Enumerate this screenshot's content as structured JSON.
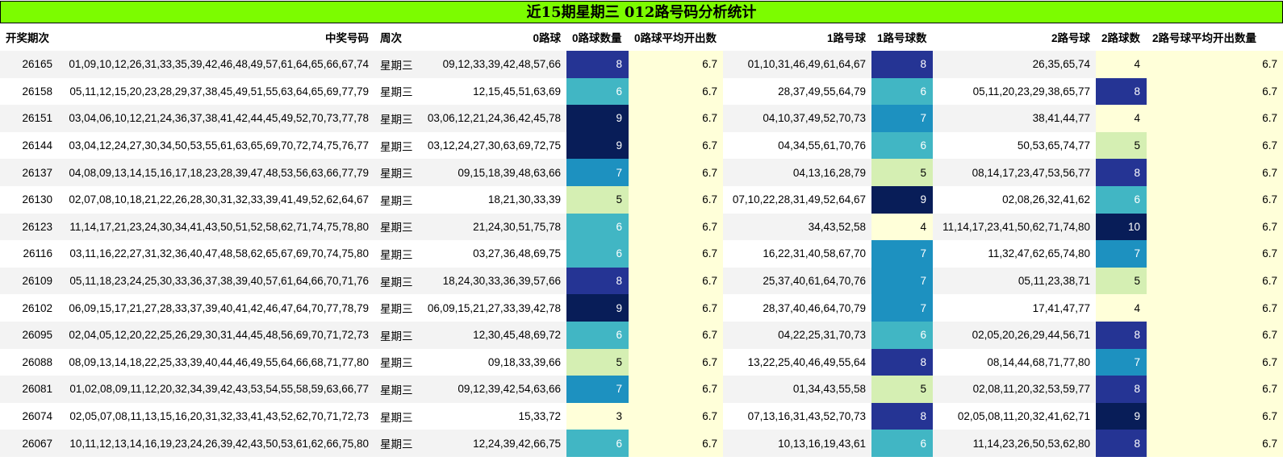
{
  "title": "近15期星期三 012路号码分析统计",
  "headers": [
    "开奖期次",
    "中奖号码",
    "周次",
    "0路球",
    "0路球数量",
    "0路球平均开出数",
    "1路号球",
    "1路号球数",
    "2路号球",
    "2路球数",
    "2路号球平均开出数量"
  ],
  "rows": [
    {
      "period": "26165",
      "numbers": "01,09,10,12,26,31,33,35,39,42,46,48,49,57,61,64,65,66,67,74",
      "weekday": "星期三",
      "r0": "09,12,33,39,42,48,57,66",
      "r0c": "8",
      "r0avg": "6.7",
      "r1": "01,10,31,46,49,61,64,67",
      "r1c": "8",
      "r2": "26,35,65,74",
      "r2c": "4",
      "r2avg": "6.7"
    },
    {
      "period": "26158",
      "numbers": "05,11,12,15,20,23,28,29,37,38,45,49,51,55,63,64,65,69,77,79",
      "weekday": "星期三",
      "r0": "12,15,45,51,63,69",
      "r0c": "6",
      "r0avg": "6.7",
      "r1": "28,37,49,55,64,79",
      "r1c": "6",
      "r2": "05,11,20,23,29,38,65,77",
      "r2c": "8",
      "r2avg": "6.7"
    },
    {
      "period": "26151",
      "numbers": "03,04,06,10,12,21,24,36,37,38,41,42,44,45,49,52,70,73,77,78",
      "weekday": "星期三",
      "r0": "03,06,12,21,24,36,42,45,78",
      "r0c": "9",
      "r0avg": "6.7",
      "r1": "04,10,37,49,52,70,73",
      "r1c": "7",
      "r2": "38,41,44,77",
      "r2c": "4",
      "r2avg": "6.7"
    },
    {
      "period": "26144",
      "numbers": "03,04,12,24,27,30,34,50,53,55,61,63,65,69,70,72,74,75,76,77",
      "weekday": "星期三",
      "r0": "03,12,24,27,30,63,69,72,75",
      "r0c": "9",
      "r0avg": "6.7",
      "r1": "04,34,55,61,70,76",
      "r1c": "6",
      "r2": "50,53,65,74,77",
      "r2c": "5",
      "r2avg": "6.7"
    },
    {
      "period": "26137",
      "numbers": "04,08,09,13,14,15,16,17,18,23,28,39,47,48,53,56,63,66,77,79",
      "weekday": "星期三",
      "r0": "09,15,18,39,48,63,66",
      "r0c": "7",
      "r0avg": "6.7",
      "r1": "04,13,16,28,79",
      "r1c": "5",
      "r2": "08,14,17,23,47,53,56,77",
      "r2c": "8",
      "r2avg": "6.7"
    },
    {
      "period": "26130",
      "numbers": "02,07,08,10,18,21,22,26,28,30,31,32,33,39,41,49,52,62,64,67",
      "weekday": "星期三",
      "r0": "18,21,30,33,39",
      "r0c": "5",
      "r0avg": "6.7",
      "r1": "07,10,22,28,31,49,52,64,67",
      "r1c": "9",
      "r2": "02,08,26,32,41,62",
      "r2c": "6",
      "r2avg": "6.7"
    },
    {
      "period": "26123",
      "numbers": "11,14,17,21,23,24,30,34,41,43,50,51,52,58,62,71,74,75,78,80",
      "weekday": "星期三",
      "r0": "21,24,30,51,75,78",
      "r0c": "6",
      "r0avg": "6.7",
      "r1": "34,43,52,58",
      "r1c": "4",
      "r2": "11,14,17,23,41,50,62,71,74,80",
      "r2c": "10",
      "r2avg": "6.7"
    },
    {
      "period": "26116",
      "numbers": "03,11,16,22,27,31,32,36,40,47,48,58,62,65,67,69,70,74,75,80",
      "weekday": "星期三",
      "r0": "03,27,36,48,69,75",
      "r0c": "6",
      "r0avg": "6.7",
      "r1": "16,22,31,40,58,67,70",
      "r1c": "7",
      "r2": "11,32,47,62,65,74,80",
      "r2c": "7",
      "r2avg": "6.7"
    },
    {
      "period": "26109",
      "numbers": "05,11,18,23,24,25,30,33,36,37,38,39,40,57,61,64,66,70,71,76",
      "weekday": "星期三",
      "r0": "18,24,30,33,36,39,57,66",
      "r0c": "8",
      "r0avg": "6.7",
      "r1": "25,37,40,61,64,70,76",
      "r1c": "7",
      "r2": "05,11,23,38,71",
      "r2c": "5",
      "r2avg": "6.7"
    },
    {
      "period": "26102",
      "numbers": "06,09,15,17,21,27,28,33,37,39,40,41,42,46,47,64,70,77,78,79",
      "weekday": "星期三",
      "r0": "06,09,15,21,27,33,39,42,78",
      "r0c": "9",
      "r0avg": "6.7",
      "r1": "28,37,40,46,64,70,79",
      "r1c": "7",
      "r2": "17,41,47,77",
      "r2c": "4",
      "r2avg": "6.7"
    },
    {
      "period": "26095",
      "numbers": "02,04,05,12,20,22,25,26,29,30,31,44,45,48,56,69,70,71,72,73",
      "weekday": "星期三",
      "r0": "12,30,45,48,69,72",
      "r0c": "6",
      "r0avg": "6.7",
      "r1": "04,22,25,31,70,73",
      "r1c": "6",
      "r2": "02,05,20,26,29,44,56,71",
      "r2c": "8",
      "r2avg": "6.7"
    },
    {
      "period": "26088",
      "numbers": "08,09,13,14,18,22,25,33,39,40,44,46,49,55,64,66,68,71,77,80",
      "weekday": "星期三",
      "r0": "09,18,33,39,66",
      "r0c": "5",
      "r0avg": "6.7",
      "r1": "13,22,25,40,46,49,55,64",
      "r1c": "8",
      "r2": "08,14,44,68,71,77,80",
      "r2c": "7",
      "r2avg": "6.7"
    },
    {
      "period": "26081",
      "numbers": "01,02,08,09,11,12,20,32,34,39,42,43,53,54,55,58,59,63,66,77",
      "weekday": "星期三",
      "r0": "09,12,39,42,54,63,66",
      "r0c": "7",
      "r0avg": "6.7",
      "r1": "01,34,43,55,58",
      "r1c": "5",
      "r2": "02,08,11,20,32,53,59,77",
      "r2c": "8",
      "r2avg": "6.7"
    },
    {
      "period": "26074",
      "numbers": "02,05,07,08,11,13,15,16,20,31,32,33,41,43,52,62,70,71,72,73",
      "weekday": "星期三",
      "r0": "15,33,72",
      "r0c": "3",
      "r0avg": "6.7",
      "r1": "07,13,16,31,43,52,70,73",
      "r1c": "8",
      "r2": "02,05,08,11,20,32,41,62,71",
      "r2c": "9",
      "r2avg": "6.7"
    },
    {
      "period": "26067",
      "numbers": "10,11,12,13,14,16,19,23,24,26,39,42,43,50,53,61,62,66,75,80",
      "weekday": "星期三",
      "r0": "12,24,39,42,66,75",
      "r0c": "6",
      "r0avg": "6.7",
      "r1": "10,13,16,19,43,61",
      "r1c": "6",
      "r2": "11,14,23,26,50,53,62,80",
      "r2c": "8",
      "r2avg": "6.7"
    }
  ],
  "heat_colors": {
    "3": "#ffffd9",
    "4": "#ffffd9",
    "5": "#d5efb3",
    "6": "#41b6c4",
    "7": "#1d91c0",
    "8": "#253494",
    "9": "#081d58",
    "10": "#081d58"
  }
}
